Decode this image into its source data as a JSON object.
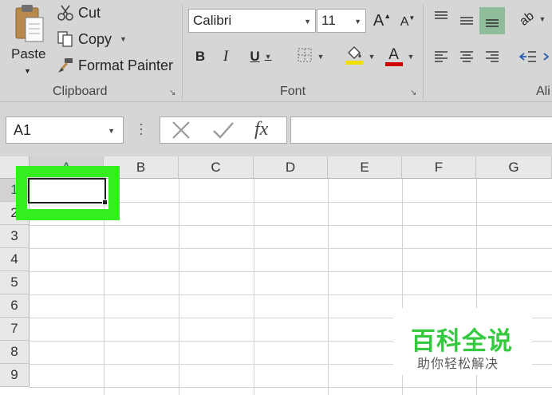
{
  "ribbon": {
    "clipboard": {
      "paste_label": "Paste",
      "cut_label": "Cut",
      "copy_label": "Copy",
      "format_painter_label": "Format Painter",
      "group_label": "Clipboard"
    },
    "font": {
      "font_name": "Calibri",
      "font_size": "11",
      "grow_label": "A",
      "shrink_label": "A",
      "bold_label": "B",
      "italic_label": "I",
      "underline_label": "U",
      "font_color_label": "A",
      "group_label": "Font",
      "highlight_color": "#f0e000",
      "font_color": "#d00000"
    },
    "alignment": {
      "group_label": "Ali",
      "active_fill": "#8fbd9b"
    }
  },
  "formula_bar": {
    "name_box": "A1",
    "fx_label": "fx",
    "formula": ""
  },
  "sheet": {
    "columns": [
      "A",
      "B",
      "C",
      "D",
      "E",
      "F",
      "G"
    ],
    "rows": [
      "1",
      "2",
      "3",
      "4",
      "5",
      "6",
      "7",
      "8",
      "9"
    ],
    "selected_cell": "A1",
    "highlight_color": "#35ee1f"
  },
  "watermark": {
    "title": "百科全说",
    "subtitle": "助你轻松解决"
  }
}
